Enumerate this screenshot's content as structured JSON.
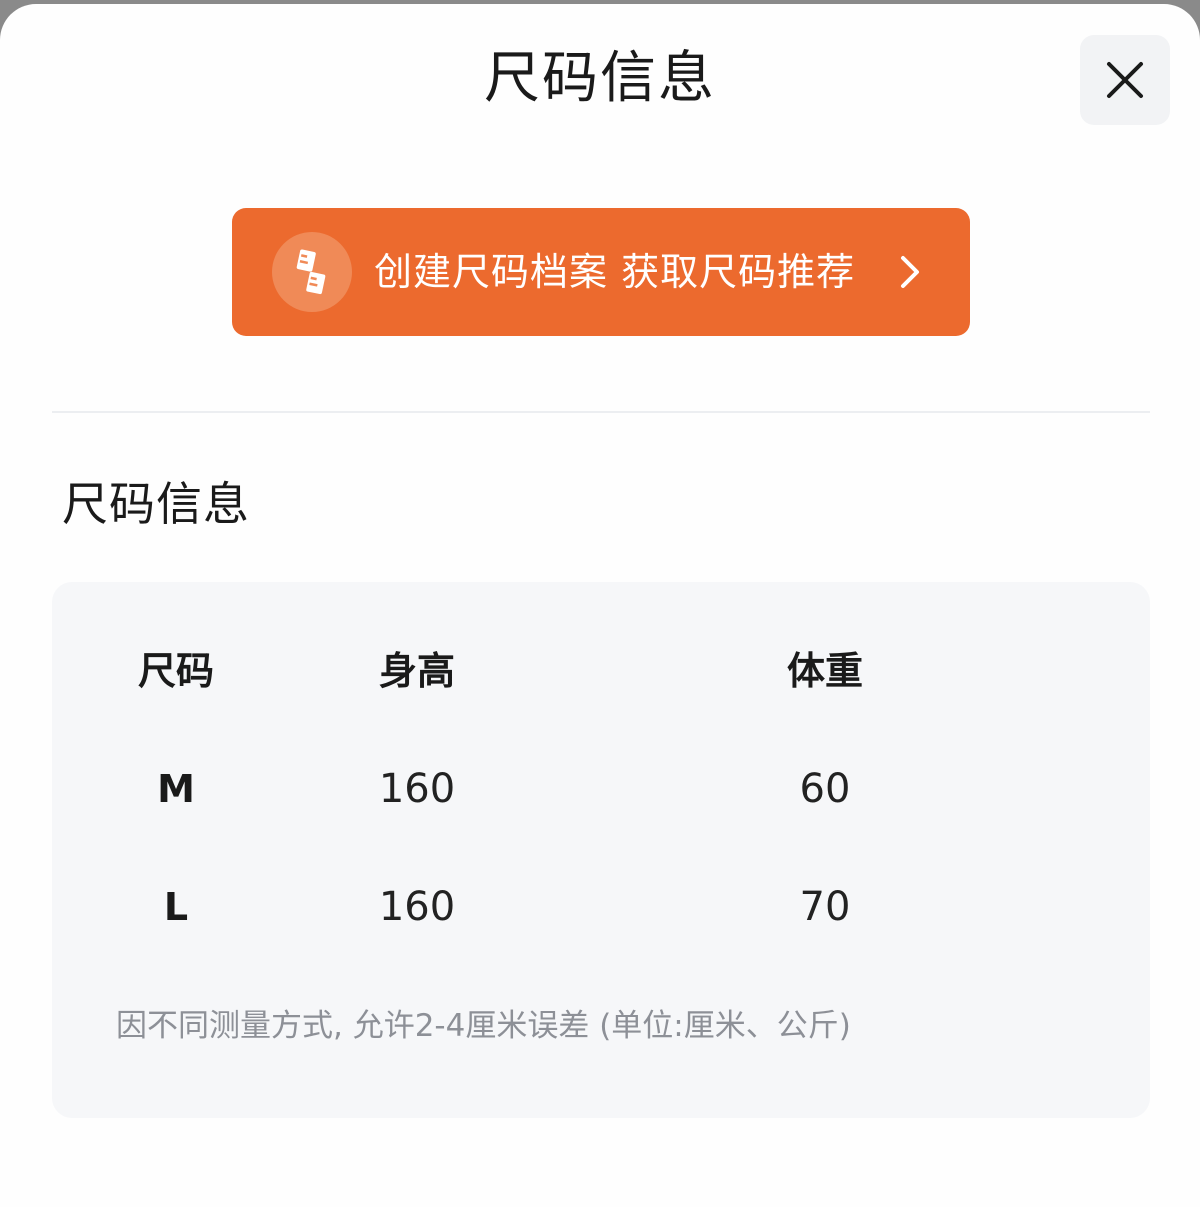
{
  "header": {
    "title": "尺码信息",
    "close_icon": "close-icon"
  },
  "cta": {
    "icon": "ruler-icon",
    "label": "创建尺码档案 获取尺码推荐",
    "chevron_icon": "chevron-right-icon",
    "color": "#ec6a2e"
  },
  "section": {
    "title": "尺码信息"
  },
  "table": {
    "headers": [
      "尺码",
      "身高",
      "体重"
    ],
    "rows": [
      [
        "M",
        "160",
        "60"
      ],
      [
        "L",
        "160",
        "70"
      ]
    ],
    "note": "因不同测量方式, 允许2-4厘米误差 (单位:厘米、公斤)"
  }
}
